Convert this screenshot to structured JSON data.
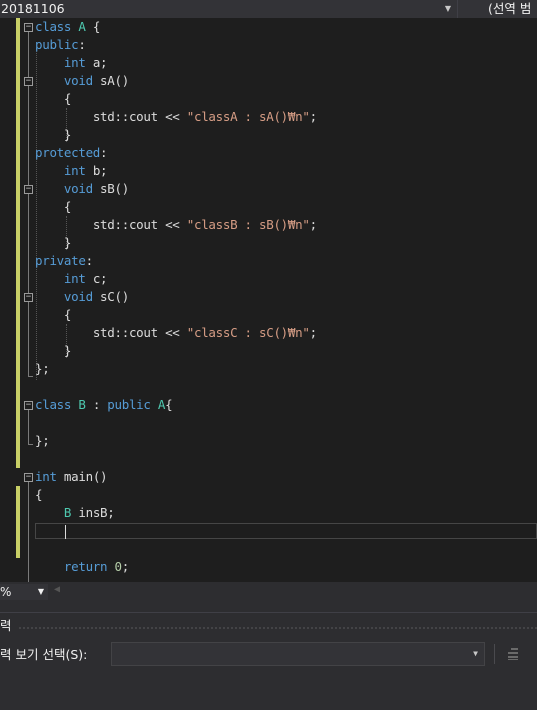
{
  "nav": {
    "left_label": "20181106",
    "right_label": "(선역 범"
  },
  "code": {
    "l1": {
      "kw": "class",
      "name": " A",
      "rest": " {"
    },
    "l2": {
      "kw": "public",
      "rest": ":"
    },
    "l3": {
      "indent": "    ",
      "kw": "int",
      "rest": " a;"
    },
    "l4": {
      "indent": "    ",
      "kw": "void",
      "rest": " sA()"
    },
    "l5": {
      "indent": "    ",
      "rest": "{"
    },
    "l6": {
      "indent": "        ",
      "pre": "std::cout << ",
      "str": "\"classA : sA()₩n\"",
      "rest": ";"
    },
    "l7": {
      "indent": "    ",
      "rest": "}"
    },
    "l8": {
      "kw": "protected",
      "rest": ":"
    },
    "l9": {
      "indent": "    ",
      "kw": "int",
      "rest": " b;"
    },
    "l10": {
      "indent": "    ",
      "kw": "void",
      "rest": " sB()"
    },
    "l11": {
      "indent": "    ",
      "rest": "{"
    },
    "l12": {
      "indent": "        ",
      "pre": "std::cout << ",
      "str": "\"classB : sB()₩n\"",
      "rest": ";"
    },
    "l13": {
      "indent": "    ",
      "rest": "}"
    },
    "l14": {
      "kw": "private",
      "rest": ":"
    },
    "l15": {
      "indent": "    ",
      "kw": "int",
      "rest": " c;"
    },
    "l16": {
      "indent": "    ",
      "kw": "void",
      "rest": " sC()"
    },
    "l17": {
      "indent": "    ",
      "rest": "{"
    },
    "l18": {
      "indent": "        ",
      "pre": "std::cout << ",
      "str": "\"classC : sC()₩n\"",
      "rest": ";"
    },
    "l19": {
      "indent": "    ",
      "rest": "}"
    },
    "l20": {
      "rest": "};"
    },
    "l22": {
      "kw": "class",
      "name": " B",
      "mid": " : ",
      "kw2": "public",
      "name2": " A",
      "rest": "{"
    },
    "l24": {
      "rest": "};"
    },
    "l26": {
      "kw": "int",
      "rest": " main()"
    },
    "l27": {
      "rest": "{"
    },
    "l28": {
      "indent": "    ",
      "name": "B",
      "rest": " insB;"
    },
    "l31": {
      "indent": "    ",
      "kw": "return",
      "num": " 0",
      "rest": ";"
    }
  },
  "zoom": {
    "value": "%"
  },
  "output": {
    "title": "력",
    "source_label": "력 보기 선택(S):",
    "source_value": ""
  },
  "colors": {
    "keyword": "#569cd6",
    "type": "#4ec9b0",
    "string": "#d69d85",
    "number": "#b5cea8",
    "changed": "#c8cf66",
    "background": "#1e1e1e"
  }
}
